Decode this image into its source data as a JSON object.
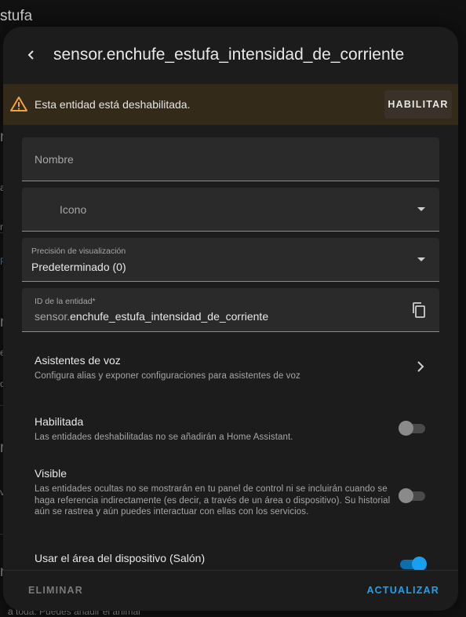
{
  "background": {
    "title_fragment": "stufa",
    "bottom_text": "a toda. Puedes añadir el animal",
    "fragments": [
      "n",
      "a",
      "r",
      "R",
      "n",
      "e",
      "o",
      "r",
      "v",
      "n"
    ]
  },
  "dialog": {
    "title": "sensor.enchufe_estufa_intensidad_de_corriente",
    "alert": {
      "message": "Esta entidad está deshabilitada.",
      "enable_button": "HABILITAR",
      "color": "#f1a33b"
    },
    "fields": {
      "name": {
        "placeholder": "Nombre"
      },
      "icon": {
        "placeholder": "Icono"
      },
      "precision": {
        "label": "Precisión de visualización",
        "value": "Predeterminado (0)"
      },
      "entity_id": {
        "label": "ID de la entidad*",
        "prefix": "sensor.",
        "value": "enchufe_estufa_intensidad_de_corriente"
      }
    },
    "voice_assistants": {
      "title": "Asistentes de voz",
      "description": "Configura alias y exponer configuraciones para asistentes de voz"
    },
    "enabled": {
      "title": "Habilitada",
      "description": "Las entidades deshabilitadas no se añadirán a Home Assistant.",
      "checked": false
    },
    "visible": {
      "title": "Visible",
      "description": "Las entidades ocultas no se mostrarán en tu panel de control ni se incluirán cuando se haga referencia indirectamente (es decir, a través de un área o dispositivo). Su historial aún se rastrea y aún puedes interactuar con ellas con los servicios.",
      "checked": false
    },
    "device_area": {
      "title": "Usar el área del dispositivo (Salón)",
      "checked": true
    },
    "footer": {
      "delete_label": "ELIMINAR",
      "update_label": "ACTUALIZAR",
      "accent_color": "#1ea0f0"
    }
  }
}
